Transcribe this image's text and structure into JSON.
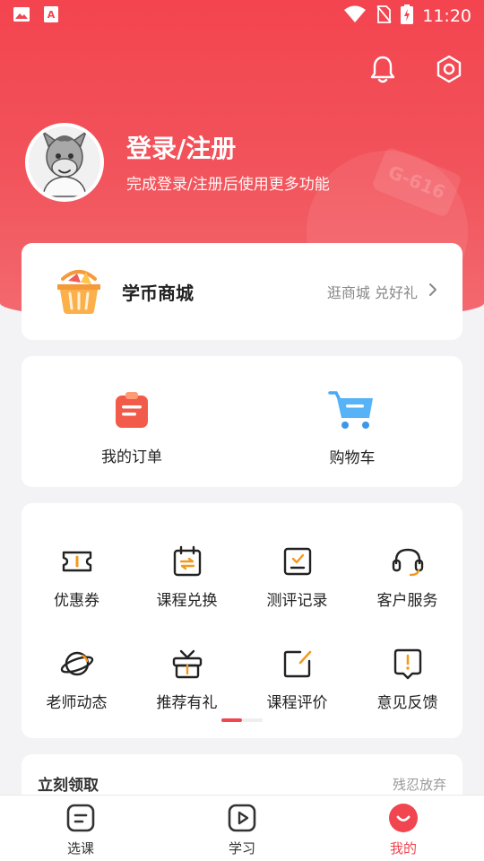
{
  "status_bar": {
    "time": "11:20"
  },
  "header": {
    "login_title": "登录/注册",
    "login_subtitle": "完成登录/注册后使用更多功能",
    "decor_plate_text": "G-616"
  },
  "mall": {
    "title": "学币商城",
    "link_text": "逛商城 兑好礼"
  },
  "orders": [
    {
      "label": "我的订单",
      "icon": "order-icon"
    },
    {
      "label": "购物车",
      "icon": "cart-icon"
    }
  ],
  "tools": [
    {
      "label": "优惠券",
      "icon": "coupon-icon"
    },
    {
      "label": "课程兑换",
      "icon": "exchange-icon"
    },
    {
      "label": "测评记录",
      "icon": "assessment-icon"
    },
    {
      "label": "客户服务",
      "icon": "headset-icon"
    },
    {
      "label": "老师动态",
      "icon": "planet-icon"
    },
    {
      "label": "推荐有礼",
      "icon": "gift-icon"
    },
    {
      "label": "课程评价",
      "icon": "review-icon"
    },
    {
      "label": "意见反馈",
      "icon": "feedback-icon"
    }
  ],
  "claim": {
    "title": "立刻领取",
    "dismiss": "残忍放弃"
  },
  "tabbar": [
    {
      "label": "选课",
      "icon": "course-select-icon",
      "active": false
    },
    {
      "label": "学习",
      "icon": "play-icon",
      "active": false
    },
    {
      "label": "我的",
      "icon": "profile-smile-icon",
      "active": true
    }
  ],
  "colors": {
    "brand": "#f14550",
    "accent_orange": "#f39a1e",
    "cart_blue": "#4aa8f5"
  }
}
